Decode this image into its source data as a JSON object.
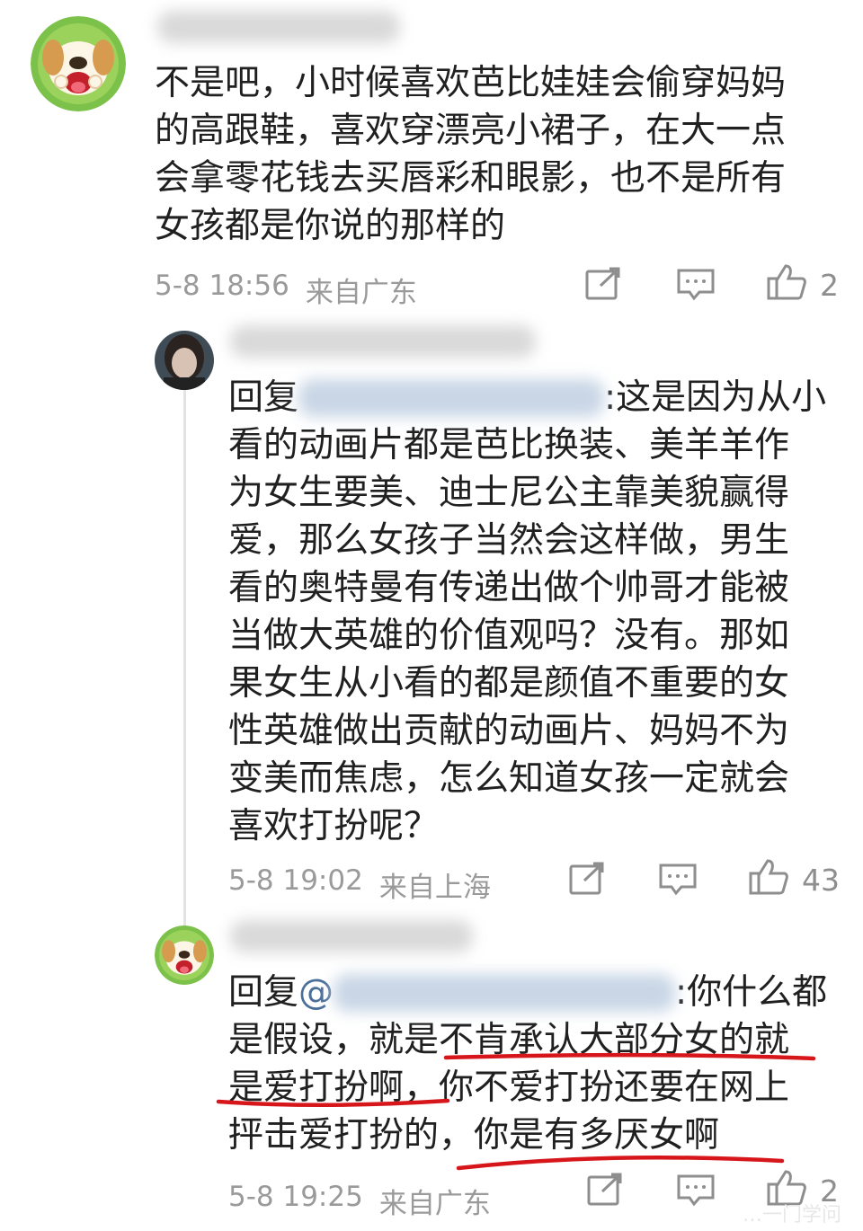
{
  "comments": [
    {
      "username_hidden": true,
      "text_lines": [
        "不是吧，小时候喜欢芭比娃娃会偷穿妈妈",
        "的高跟鞋，喜欢穿漂亮小裙子，在大一点",
        "会拿零花钱去买唇彩和眼影，也不是所有",
        "女孩都是你说的那样的"
      ],
      "time": "5-8 18:56",
      "location": "来自广东",
      "likes": "2",
      "icons": [
        "share-icon",
        "comment-icon",
        "like-icon"
      ]
    },
    {
      "username_hidden": true,
      "reply_prefix": "回复",
      "reply_tail": ":这是因为从小",
      "text_lines": [
        "看的动画片都是芭比换装、美羊羊作",
        "为女生要美、迪士尼公主靠美貌赢得",
        "爱，那么女孩子当然会这样做，男生",
        "看的奥特曼有传递出做个帅哥才能被",
        "当做大英雄的价值观吗？没有。那如",
        "果女生从小看的都是颜值不重要的女",
        "性英雄做出贡献的动画片、妈妈不为",
        "变美而焦虑，怎么知道女孩一定就会",
        "喜欢打扮呢？"
      ],
      "time": "5-8 19:02",
      "location": "来自上海",
      "likes": "43"
    },
    {
      "username_hidden": true,
      "reply_prefix": "回复",
      "reply_at": "@",
      "reply_tail": ":你什么都",
      "line2": "是假设，就是不肯承认大部分女的就",
      "line3": "是爱打扮啊，你不爱打扮还要在网上",
      "line4": "抨击爱打扮的，你是有多厌女啊",
      "time": "5-8 19:25",
      "location": "来自广东",
      "likes": "2"
    }
  ],
  "colors": {
    "annotation": "#d6161a",
    "link": "#4a6f98",
    "meta": "#9a9a9a"
  },
  "watermark": "…一门学问"
}
